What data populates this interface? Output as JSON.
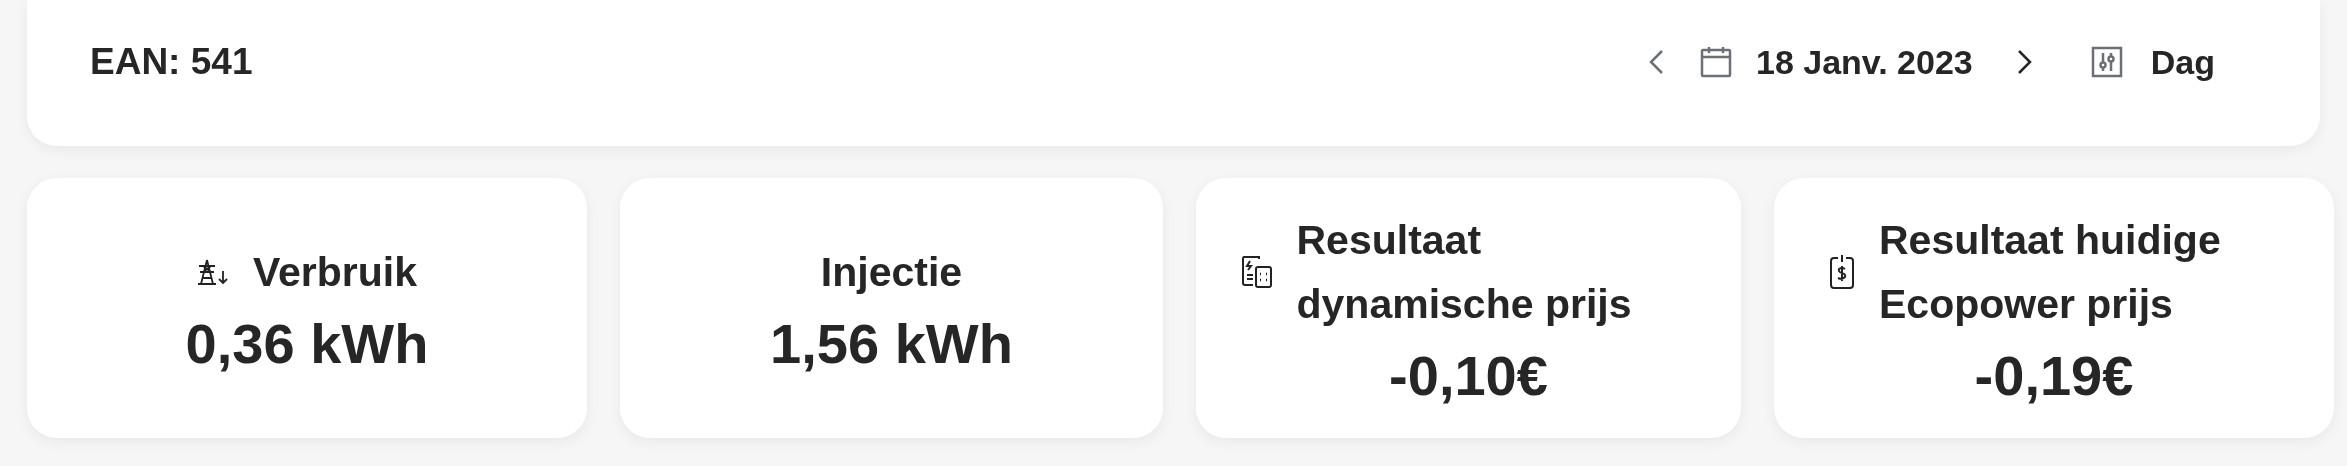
{
  "header": {
    "ean_label": "EAN: 541",
    "date": "18 Janv. 2023",
    "period": "Dag"
  },
  "cards": [
    {
      "kind": "pylon",
      "title": "Verbruik",
      "value": "0,36 kWh"
    },
    {
      "kind": "plain",
      "title": "Injectie",
      "value": "1,56 kWh"
    },
    {
      "kind": "calculator",
      "title": "Resultaat dynamische prijs",
      "value": "-0,10€"
    },
    {
      "kind": "price-tag",
      "title": "Resultaat huidige Ecopower prijs",
      "value": "-0,19€"
    }
  ]
}
